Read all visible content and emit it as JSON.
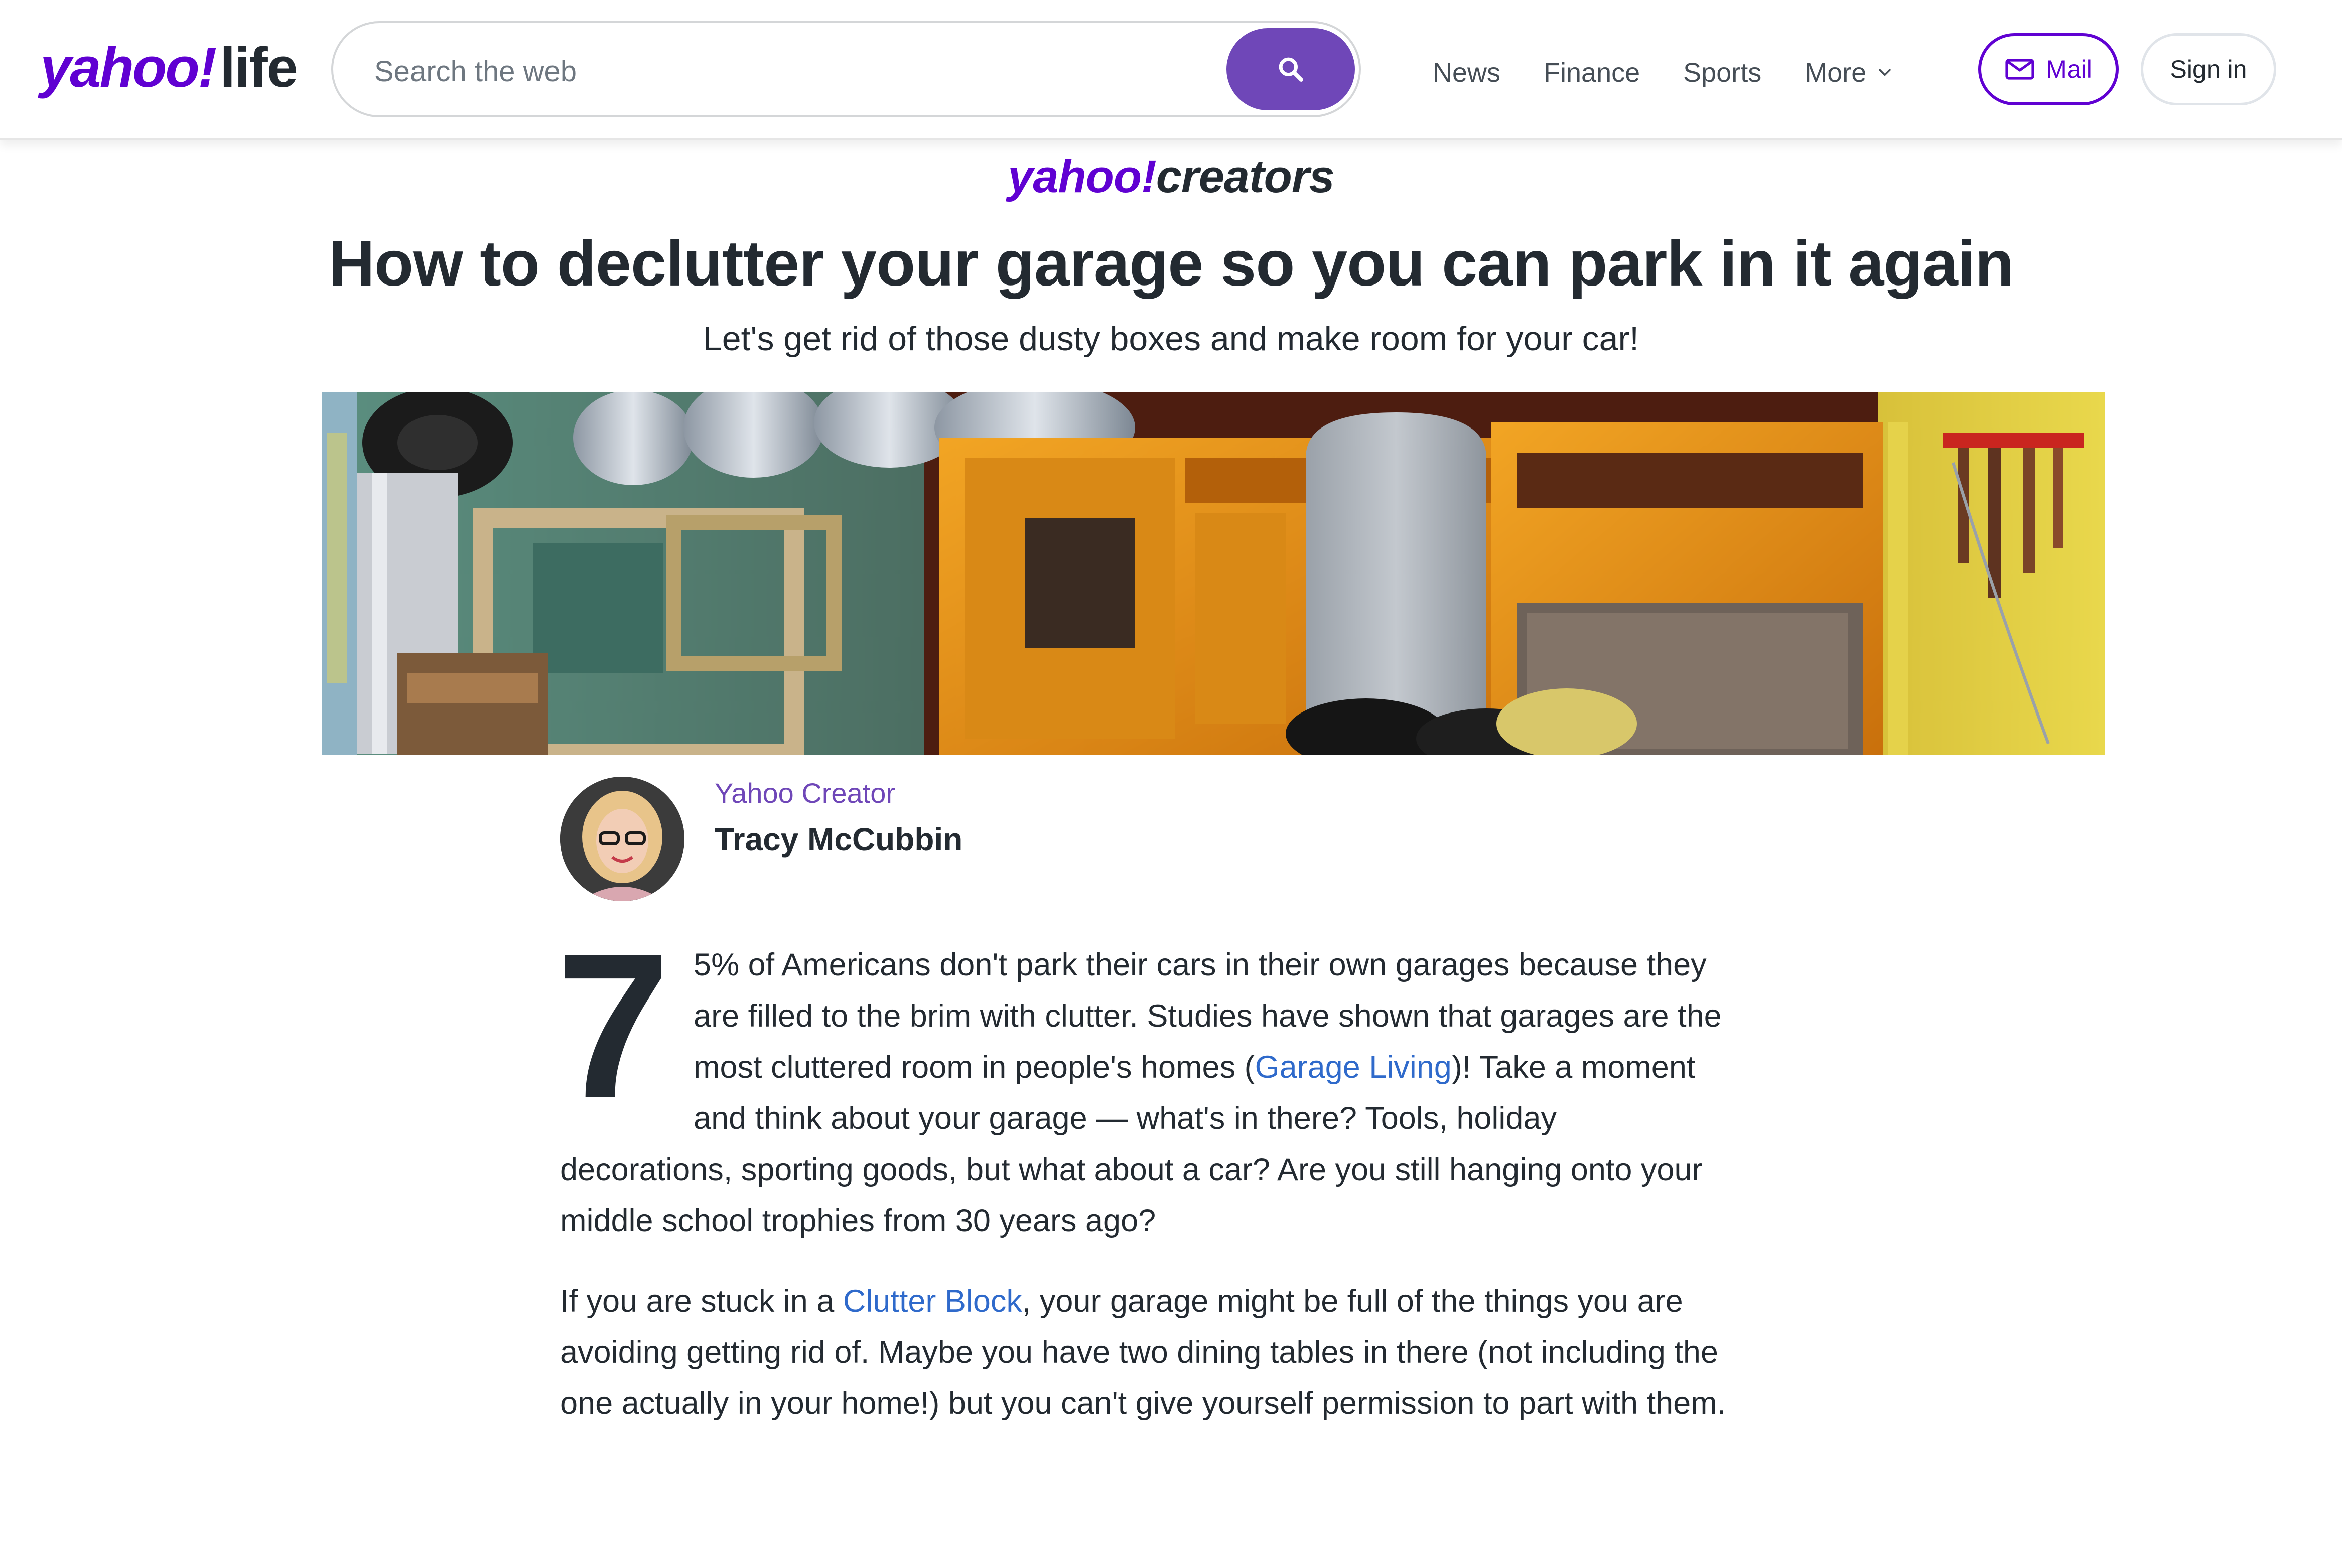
{
  "header": {
    "logo": {
      "brand": "yahoo",
      "bang": "!",
      "property": "life"
    },
    "search": {
      "placeholder": "Search the web",
      "button_icon": "search-icon"
    },
    "nav": [
      {
        "label": "News"
      },
      {
        "label": "Finance"
      },
      {
        "label": "Sports"
      },
      {
        "label": "More",
        "icon": "chevron-down-icon"
      }
    ],
    "mail_label": "Mail",
    "signin_label": "Sign in"
  },
  "article": {
    "section_logo": {
      "brand": "yahoo!",
      "suffix": "creators"
    },
    "headline": "How to declutter your garage so you can park in it again",
    "subhead": "Let's get rid of those dusty boxes and make room for your car!",
    "byline": {
      "role": "Yahoo Creator",
      "author": "Tracy McCubbin"
    },
    "paragraph1": {
      "dropcap": "7",
      "text_before_link": "5% of Americans don't park their cars in their own garages because they are filled to the brim with clutter. Studies have shown that garages are the most cluttered room in people's homes (",
      "link": "Garage Living",
      "text_after_link": ")! Take a moment and think about your garage — what's in there? Tools, holiday decorations, sporting goods, but what about a car? Are you still hanging onto your middle school trophies from 30 years ago?"
    },
    "paragraph2": {
      "text_before_link": "If you are stuck in a ",
      "link": "Clutter Block",
      "text_after_link": ", your garage might be full of the things you are avoiding getting rid of. Maybe you have two dining tables in there (not including the one actually in your home!) but you can't give yourself permission to part with them."
    }
  },
  "colors": {
    "brand_purple": "#6001d2",
    "search_button": "#6f47b8",
    "link_blue": "#2f6acb",
    "text_dark": "#232a31"
  }
}
